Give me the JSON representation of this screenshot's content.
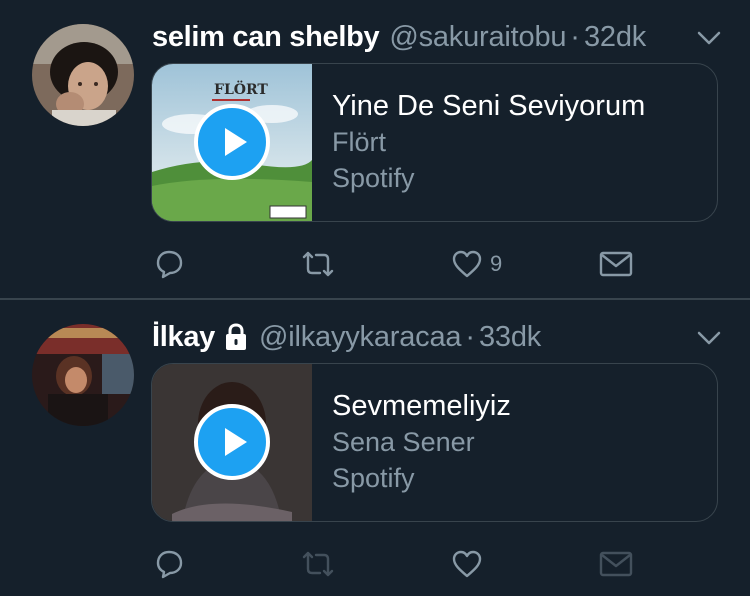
{
  "colors": {
    "background": "#15202b",
    "secondary_text": "#8899a6",
    "divider": "#38444d",
    "accent": "#1da1f2"
  },
  "tweets": [
    {
      "name": "selim can shelby",
      "handle": "@sakuraitobu",
      "separator": "·",
      "time": "32dk",
      "protected": false,
      "card": {
        "title": "Yine De Seni Seviyorum",
        "artist": "Flört",
        "source": "Spotify",
        "art_text": "FLÖRT"
      },
      "actions": {
        "reply_icon": "reply-icon",
        "retweet_icon": "retweet-icon",
        "like_icon": "heart-icon",
        "like_count": "9",
        "dm_icon": "envelope-icon"
      }
    },
    {
      "name": "İlkay",
      "handle": "@ilkayykaracaa",
      "separator": "·",
      "time": "33dk",
      "protected": true,
      "card": {
        "title": "Sevmemeliyiz",
        "artist": "Sena Sener",
        "source": "Spotify",
        "art_text": ""
      },
      "actions": {
        "reply_icon": "reply-icon",
        "retweet_icon": "retweet-icon",
        "like_icon": "heart-icon",
        "like_count": "",
        "dm_icon": "envelope-icon"
      }
    }
  ]
}
